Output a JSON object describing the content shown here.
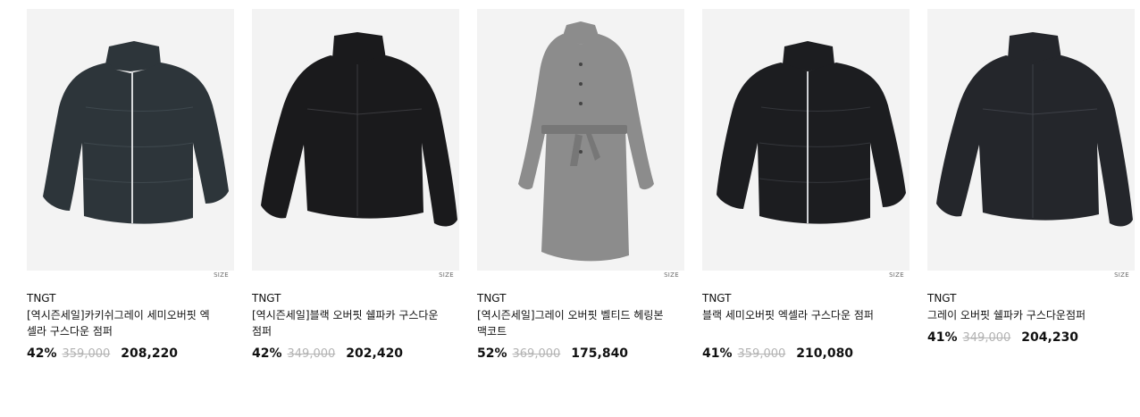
{
  "products": [
    {
      "brand": "TNGT",
      "size_label": "SIZE",
      "name": "[역시즌세일]카키쉬그레이 세미오버핏 엑셀라 구스다운 점퍼",
      "discount": "42%",
      "original_price": "359,000",
      "sale_price": "208,220",
      "image": "dark-green-puffer-jacket",
      "color": "#2d353a"
    },
    {
      "brand": "TNGT",
      "size_label": "SIZE",
      "name": "[역시즌세일]블랙 오버핏 쉘파카 구스다운점퍼",
      "discount": "42%",
      "original_price": "349,000",
      "sale_price": "202,420",
      "image": "black-parka-jacket",
      "color": "#1a1a1c"
    },
    {
      "brand": "TNGT",
      "size_label": "SIZE",
      "name": "[역시즌세일]그레이 오버핏 벨티드 헤링본 맥코트",
      "discount": "52%",
      "original_price": "369,000",
      "sale_price": "175,840",
      "image": "gray-herringbone-coat",
      "color": "#8c8c8c"
    },
    {
      "brand": "TNGT",
      "size_label": "SIZE",
      "name": "블랙 세미오버핏 엑셀라 구스다운 점퍼",
      "discount": "41%",
      "original_price": "359,000",
      "sale_price": "210,080",
      "image": "black-puffer-jacket",
      "color": "#1c1d20"
    },
    {
      "brand": "TNGT",
      "size_label": "SIZE",
      "name": "그레이 오버핏 쉘파카 구스다운점퍼",
      "discount": "41%",
      "original_price": "349,000",
      "sale_price": "204,230",
      "image": "charcoal-parka-jacket",
      "color": "#24262b"
    }
  ]
}
